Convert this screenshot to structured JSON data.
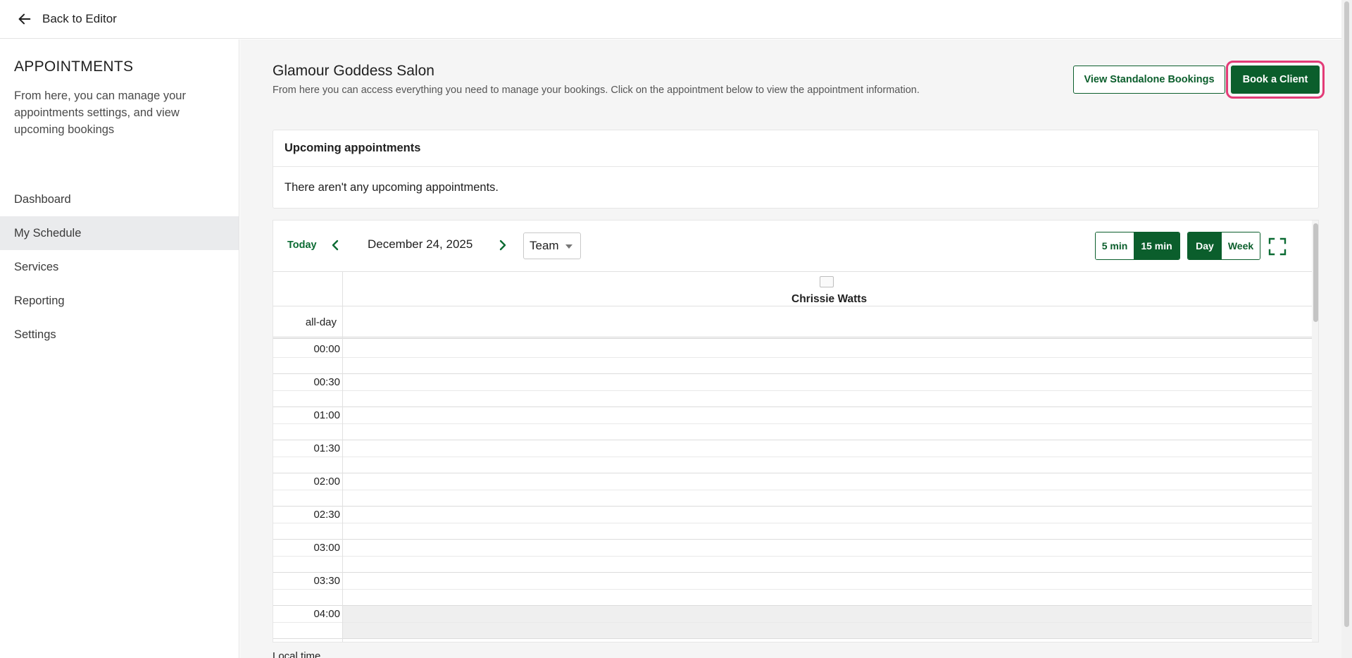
{
  "topbar": {
    "back_label": "Back to Editor"
  },
  "sidebar": {
    "title": "APPOINTMENTS",
    "description": "From here, you can manage your appointments settings, and view upcoming bookings",
    "items": [
      {
        "label": "Dashboard",
        "active": false
      },
      {
        "label": "My Schedule",
        "active": true
      },
      {
        "label": "Services",
        "active": false
      },
      {
        "label": "Reporting",
        "active": false
      },
      {
        "label": "Settings",
        "active": false
      }
    ]
  },
  "header": {
    "title": "Glamour Goddess Salon",
    "subtitle": "From here you can access everything you need to manage your bookings. Click on the appointment below to view the appointment information.",
    "standalone_button": "View Standalone Bookings",
    "book_button": "Book a Client"
  },
  "upcoming": {
    "title": "Upcoming appointments",
    "empty_text": "There aren't any upcoming appointments."
  },
  "calendar": {
    "today_label": "Today",
    "date_label": "December 24, 2025",
    "team_select": "Team",
    "interval_options": [
      "5 min",
      "15 min"
    ],
    "interval_selected": "15 min",
    "view_options": [
      "Day",
      "Week"
    ],
    "view_selected": "Day",
    "staff_name": "Chrissie Watts",
    "allday_label": "all-day",
    "time_labels": [
      "00:00",
      "00:30",
      "01:00",
      "01:30",
      "02:00",
      "02:30",
      "03:00",
      "03:30",
      "04:00"
    ],
    "footer_label": "Local time"
  },
  "colors": {
    "brand_green": "#0b5e2c",
    "highlight_pink": "#e33b77"
  },
  "icons": {
    "back": "arrow-left-icon",
    "prev": "chevron-left-icon",
    "next": "chevron-right-icon",
    "fullscreen": "fullscreen-icon"
  }
}
